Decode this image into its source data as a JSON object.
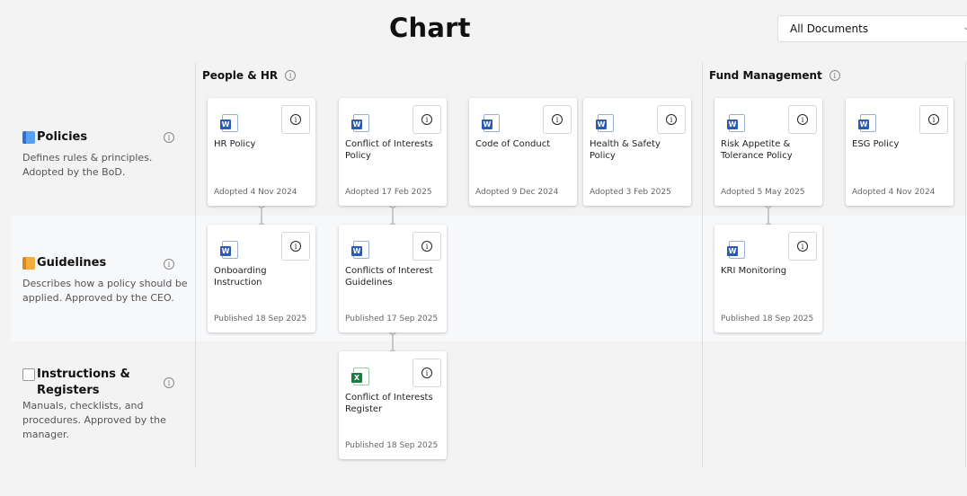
{
  "header": {
    "title": "Chart",
    "filter": {
      "selected": "All Documents"
    }
  },
  "groups": [
    {
      "label": "People & HR"
    },
    {
      "label": "Fund Management"
    }
  ],
  "rows": [
    {
      "emoji": "blue-book",
      "label": "Policies",
      "description": "Defines rules & principles. Adopted by the BoD."
    },
    {
      "emoji": "orange-book",
      "label": "Guidelines",
      "description": "Describes how a policy should be applied. Approved by the CEO."
    },
    {
      "emoji": "page",
      "label": "Instructions & Registers",
      "description": "Manuals, checklists, and procedures. Approved by the manager."
    }
  ],
  "cards": {
    "hr_policy": {
      "type": "word",
      "title": "HR Policy",
      "status": "Adopted 4 Nov 2024"
    },
    "conflict_policy": {
      "type": "word",
      "title": "Conflict of Interests Policy",
      "status": "Adopted 17 Feb 2025"
    },
    "code_of_conduct": {
      "type": "word",
      "title": "Code of Conduct",
      "status": "Adopted 9 Dec 2024"
    },
    "health_safety": {
      "type": "word",
      "title": "Health & Safety Policy",
      "status": "Adopted 3 Feb 2025"
    },
    "risk_appetite": {
      "type": "word",
      "title": "Risk Appetite & Tolerance Policy",
      "status": "Adopted 5 May 2025"
    },
    "esg_policy": {
      "type": "word",
      "title": "ESG Policy",
      "status": "Adopted 4 Nov 2024"
    },
    "onboarding": {
      "type": "word",
      "title": "Onboarding Instruction",
      "status": "Published 18 Sep 2025"
    },
    "conflicts_guidelines": {
      "type": "word",
      "title": "Conflicts of Interest Guidelines",
      "status": "Published 17 Sep 2025"
    },
    "kri_monitoring": {
      "type": "word",
      "title": "KRI Monitoring",
      "status": "Published 18 Sep 2025"
    },
    "conflict_register": {
      "type": "excel",
      "title": "Conflict of Interests Register",
      "status": "Published 18 Sep 2025"
    }
  },
  "icons": {
    "word_badge": "W",
    "excel_badge": "X",
    "info_glyph": "i",
    "chevron": "⌄"
  }
}
